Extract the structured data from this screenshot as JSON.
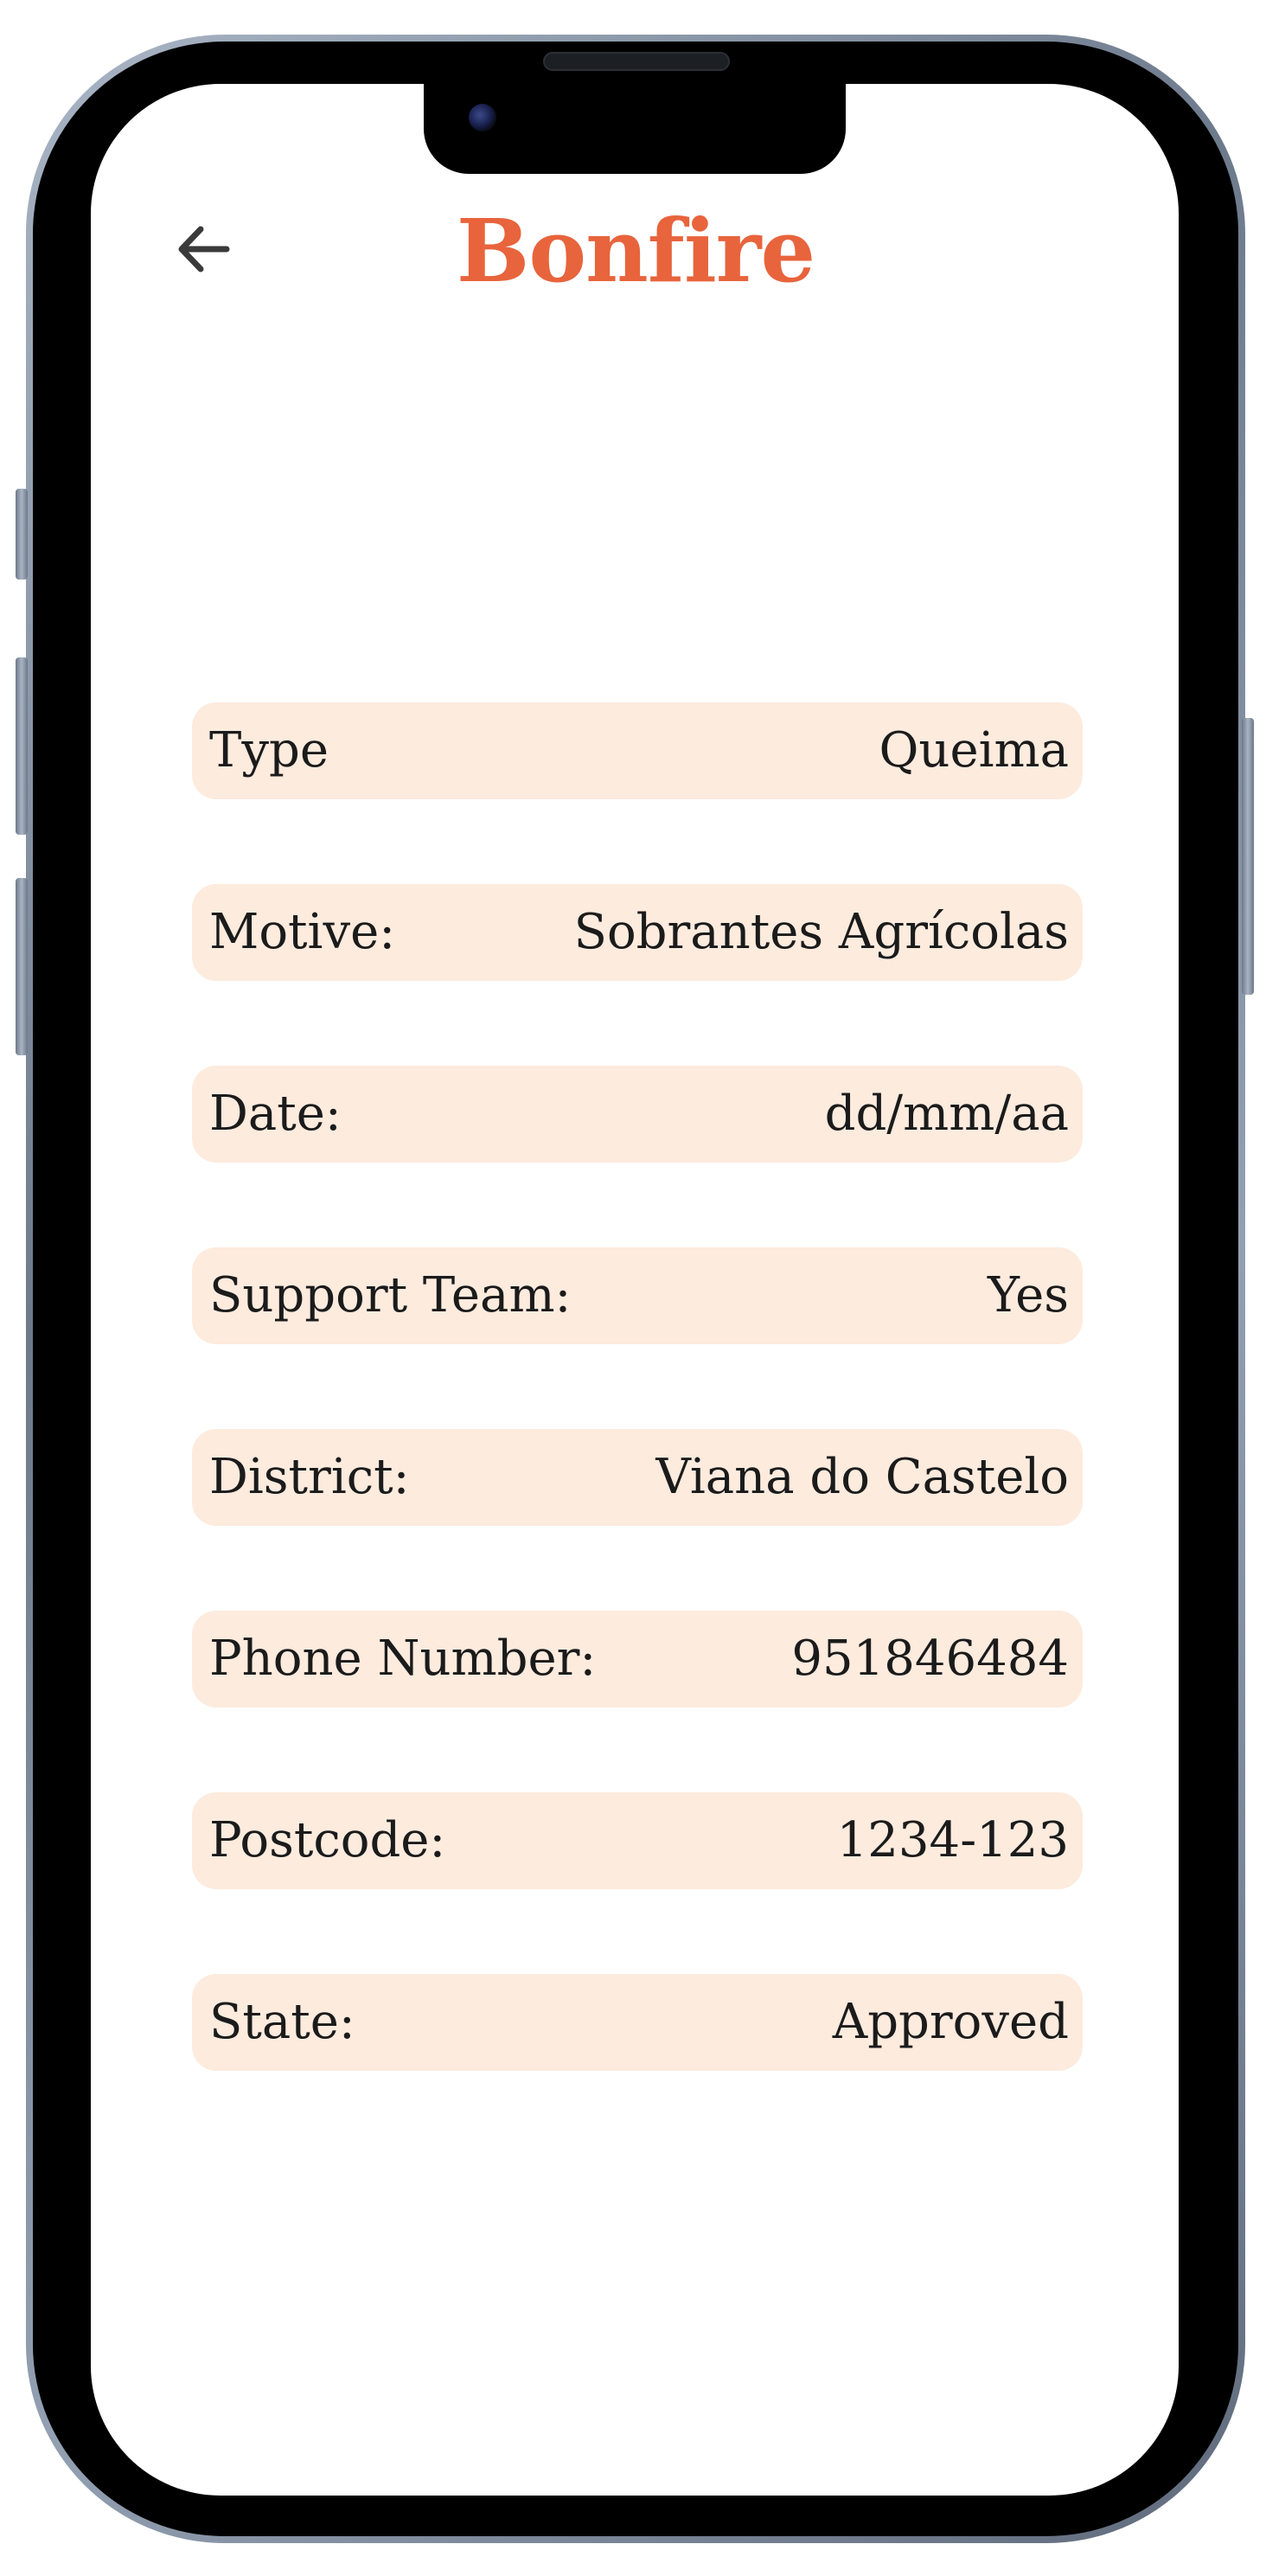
{
  "app": {
    "title": "Bonfire",
    "accent_color": "#e8643c",
    "field_background": "#fdebde"
  },
  "header": {
    "back_icon": "arrow-left-icon"
  },
  "fields": [
    {
      "label": "Type",
      "value": "Queima"
    },
    {
      "label": "Motive:",
      "value": "Sobrantes Agrícolas"
    },
    {
      "label": "Date:",
      "value": "dd/mm/aa"
    },
    {
      "label": "Support Team:",
      "value": "Yes"
    },
    {
      "label": "District:",
      "value": "Viana do Castelo"
    },
    {
      "label": "Phone Number:",
      "value": "951846484"
    },
    {
      "label": "Postcode:",
      "value": "1234-123"
    },
    {
      "label": "State:",
      "value": "Approved"
    }
  ]
}
